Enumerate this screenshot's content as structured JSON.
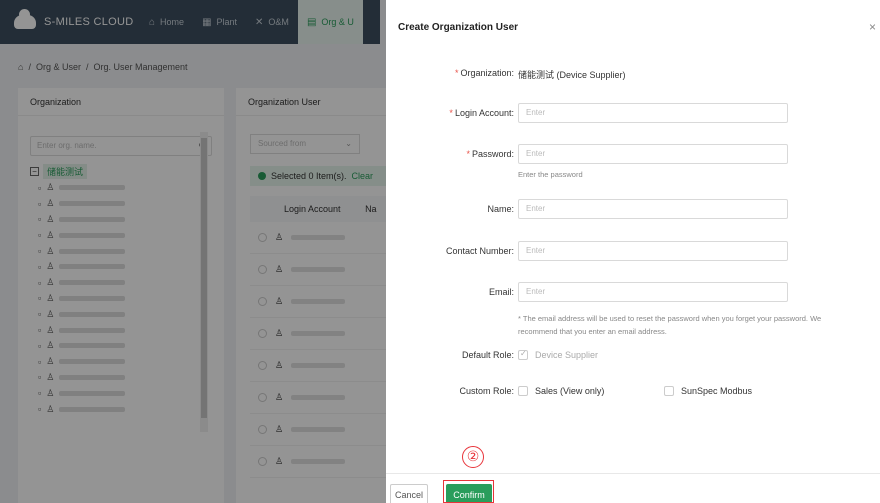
{
  "app": {
    "name": "S-MILES CLOUD",
    "nav": [
      {
        "label": "Home",
        "icon": "home-icon"
      },
      {
        "label": "Plant",
        "icon": "plant-icon"
      },
      {
        "label": "O&M",
        "icon": "tools-icon"
      },
      {
        "label": "Org & U",
        "icon": "org-icon",
        "active": true
      }
    ]
  },
  "breadcrumb": [
    "Org & User",
    "Org. User Management"
  ],
  "org_panel": {
    "title": "Organization",
    "search_placeholder": "Enter org. name.",
    "root": "储能测试"
  },
  "user_panel": {
    "title": "Organization User",
    "filter_placeholder": "Sourced from",
    "selected_text": "Selected 0 Item(s).",
    "clear_label": "Clear",
    "column_login": "Login Account",
    "column_name": "Na"
  },
  "drawer": {
    "title": "Create Organization User",
    "organization": {
      "label": "Organization",
      "value": "储能测试 (Device Supplier)"
    },
    "login_account": {
      "label": "Login Account",
      "placeholder": "Enter"
    },
    "password": {
      "label": "Password",
      "placeholder": "Enter",
      "hint": "Enter the password"
    },
    "name": {
      "label": "Name",
      "placeholder": "Enter"
    },
    "contact": {
      "label": "Contact Number",
      "placeholder": "Enter"
    },
    "email": {
      "label": "Email",
      "placeholder": "Enter",
      "hint_line1": "* The email address will be used to reset the password when you forget your password. We",
      "hint_line2": "recommend that you enter an email address."
    },
    "default_role": {
      "label": "Default Role",
      "value": "Device Supplier"
    },
    "custom_role": {
      "label": "Custom Role",
      "options": [
        "Sales (View only)",
        "SunSpec Modbus"
      ]
    },
    "cancel_label": "Cancel",
    "confirm_label": "Confirm"
  },
  "annotation": {
    "number": "②",
    "color": "#e8343a"
  },
  "colors": {
    "accent": "#2a9d5c",
    "topbar": "#3d4f5f",
    "required": "#e8534a"
  }
}
